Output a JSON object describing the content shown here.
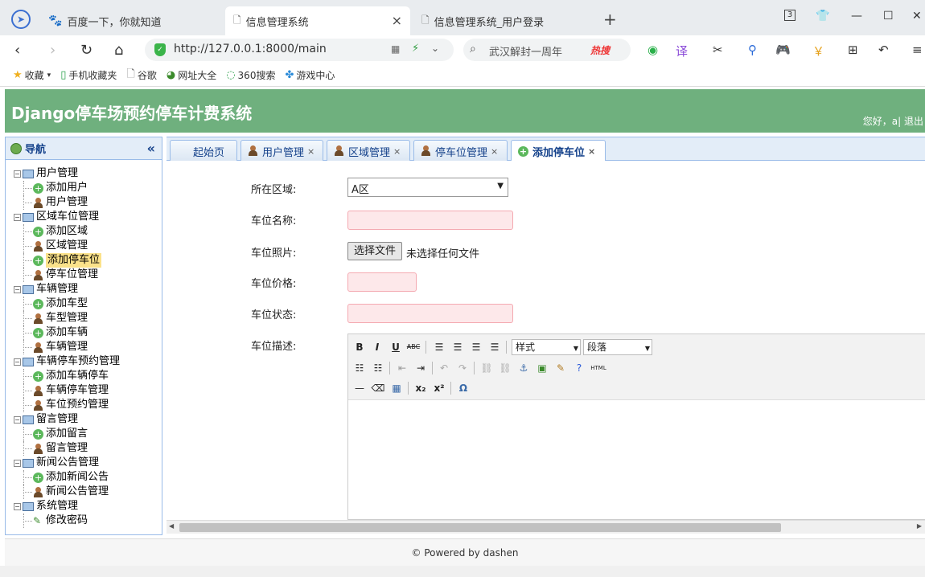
{
  "browser": {
    "tabs": [
      {
        "title": "百度一下，你就知道"
      },
      {
        "title": "信息管理系统"
      },
      {
        "title": "信息管理系统_用户登录"
      }
    ],
    "tab_count": "3",
    "url": "http://127.0.0.1:8000/main",
    "search_text": "武汉解封一周年",
    "hot_label": "热搜",
    "bookmarks": [
      "收藏",
      "手机收藏夹",
      "谷歌",
      "网址大全",
      "360搜索",
      "游戏中心"
    ]
  },
  "app": {
    "title": "Django停车场预约停车计费系统",
    "welcome": "您好，a| 退出",
    "accent_color": "#6fb07e"
  },
  "sidebar": {
    "title": "导航",
    "groups": [
      {
        "label": "用户管理",
        "items": [
          {
            "label": "添加用户",
            "icon": "add"
          },
          {
            "label": "用户管理",
            "icon": "user"
          }
        ]
      },
      {
        "label": "区域车位管理",
        "items": [
          {
            "label": "添加区域",
            "icon": "add"
          },
          {
            "label": "区域管理",
            "icon": "user"
          },
          {
            "label": "添加停车位",
            "icon": "add",
            "selected": true
          },
          {
            "label": "停车位管理",
            "icon": "user"
          }
        ]
      },
      {
        "label": "车辆管理",
        "items": [
          {
            "label": "添加车型",
            "icon": "add"
          },
          {
            "label": "车型管理",
            "icon": "user"
          },
          {
            "label": "添加车辆",
            "icon": "add"
          },
          {
            "label": "车辆管理",
            "icon": "user"
          }
        ]
      },
      {
        "label": "车辆停车预约管理",
        "items": [
          {
            "label": "添加车辆停车",
            "icon": "add"
          },
          {
            "label": "车辆停车管理",
            "icon": "user"
          },
          {
            "label": "车位预约管理",
            "icon": "user"
          }
        ]
      },
      {
        "label": "留言管理",
        "items": [
          {
            "label": "添加留言",
            "icon": "add"
          },
          {
            "label": "留言管理",
            "icon": "user"
          }
        ]
      },
      {
        "label": "新闻公告管理",
        "items": [
          {
            "label": "添加新闻公告",
            "icon": "add"
          },
          {
            "label": "新闻公告管理",
            "icon": "user"
          }
        ]
      },
      {
        "label": "系统管理",
        "items": [
          {
            "label": "修改密码",
            "icon": "pencil"
          }
        ]
      }
    ]
  },
  "content_tabs": [
    {
      "label": "起始页",
      "closable": false
    },
    {
      "label": "用户管理",
      "closable": true
    },
    {
      "label": "区域管理",
      "closable": true
    },
    {
      "label": "停车位管理",
      "closable": true
    },
    {
      "label": "添加停车位",
      "closable": true,
      "active": true
    }
  ],
  "form": {
    "area_label": "所在区域:",
    "area_value": "A区",
    "name_label": "车位名称:",
    "photo_label": "车位照片:",
    "file_button": "选择文件",
    "file_status": "未选择任何文件",
    "price_label": "车位价格:",
    "status_label": "车位状态:",
    "desc_label": "车位描述:"
  },
  "editor": {
    "style_dropdown": "样式",
    "paragraph_dropdown": "段落",
    "html_button": "HTML"
  },
  "footer": "© Powered by dashen"
}
